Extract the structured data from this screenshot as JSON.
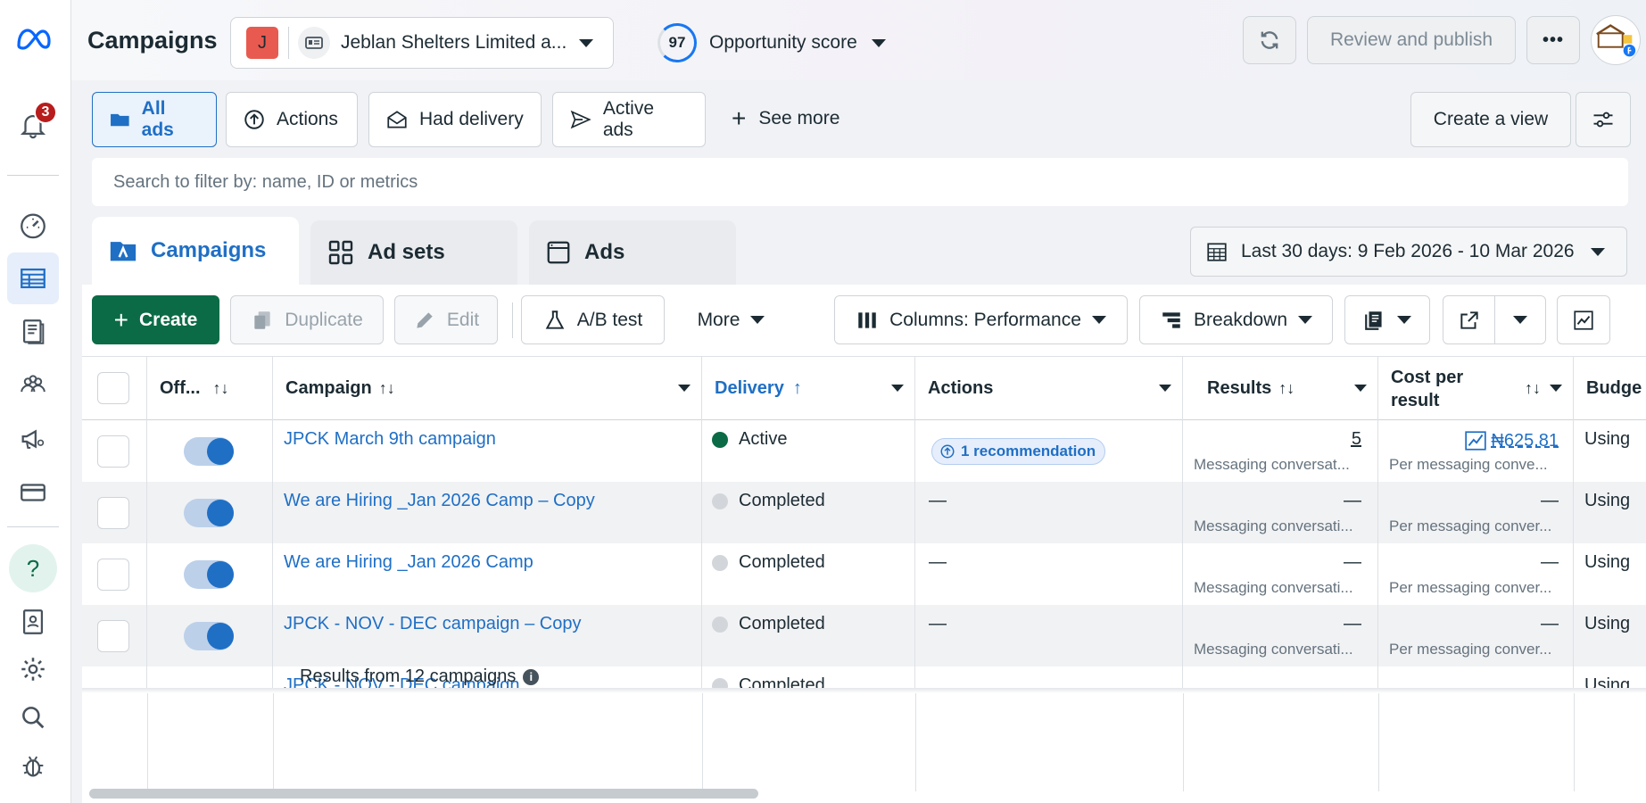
{
  "rail": {
    "notification_count": "3"
  },
  "header": {
    "title": "Campaigns",
    "account_initial": "J",
    "account_name": "Jeblan Shelters Limited a...",
    "opportunity_score": "97",
    "opportunity_label": "Opportunity score",
    "review_publish": "Review and publish",
    "more": "•••"
  },
  "views": {
    "items": [
      "All ads",
      "Actions",
      "Had delivery",
      "Active ads"
    ],
    "see_more": "See more",
    "create_view": "Create a view"
  },
  "search": {
    "placeholder": "Search to filter by: name, ID or metrics"
  },
  "levels": {
    "campaigns": "Campaigns",
    "ad_sets": "Ad sets",
    "ads": "Ads"
  },
  "date_range": "Last 30 days: 9 Feb 2026 - 10 Mar 2026",
  "toolbar": {
    "create": "Create",
    "duplicate": "Duplicate",
    "edit": "Edit",
    "ab_test": "A/B test",
    "more": "More",
    "columns": "Columns: Performance",
    "breakdown": "Breakdown"
  },
  "table": {
    "headers": {
      "off_on": "Off...",
      "campaign": "Campaign",
      "delivery": "Delivery",
      "actions": "Actions",
      "results": "Results",
      "cost_per_result": "Cost per result",
      "budget": "Budge"
    },
    "rows": [
      {
        "name": "JPCK March 9th campaign",
        "delivery": "Active",
        "actions": "1 recommendation",
        "results": "5",
        "results_sub": "Messaging conversat...",
        "cost": "₦625.81",
        "cost_sub": "Per messaging conve...",
        "budget": "Using"
      },
      {
        "name": "We are Hiring _Jan 2026 Camp – Copy",
        "delivery": "Completed",
        "actions": "—",
        "results": "—",
        "results_sub": "Messaging conversati...",
        "cost": "—",
        "cost_sub": "Per messaging conver...",
        "budget": "Using"
      },
      {
        "name": "We are Hiring _Jan 2026 Camp",
        "delivery": "Completed",
        "actions": "—",
        "results": "—",
        "results_sub": "Messaging conversati...",
        "cost": "—",
        "cost_sub": "Per messaging conver...",
        "budget": "Using"
      },
      {
        "name": "JPCK - NOV - DEC campaign – Copy",
        "delivery": "Completed",
        "actions": "—",
        "results": "—",
        "results_sub": "Messaging conversati...",
        "cost": "—",
        "cost_sub": "Per messaging conver...",
        "budget": "Using"
      },
      {
        "name": "JPCK - NOV - DEC campaign",
        "delivery": "Completed",
        "actions": "",
        "results": "",
        "results_sub": "",
        "cost": "",
        "cost_sub": "",
        "budget": "Using"
      }
    ],
    "footer": "Results from 12 campaigns"
  }
}
